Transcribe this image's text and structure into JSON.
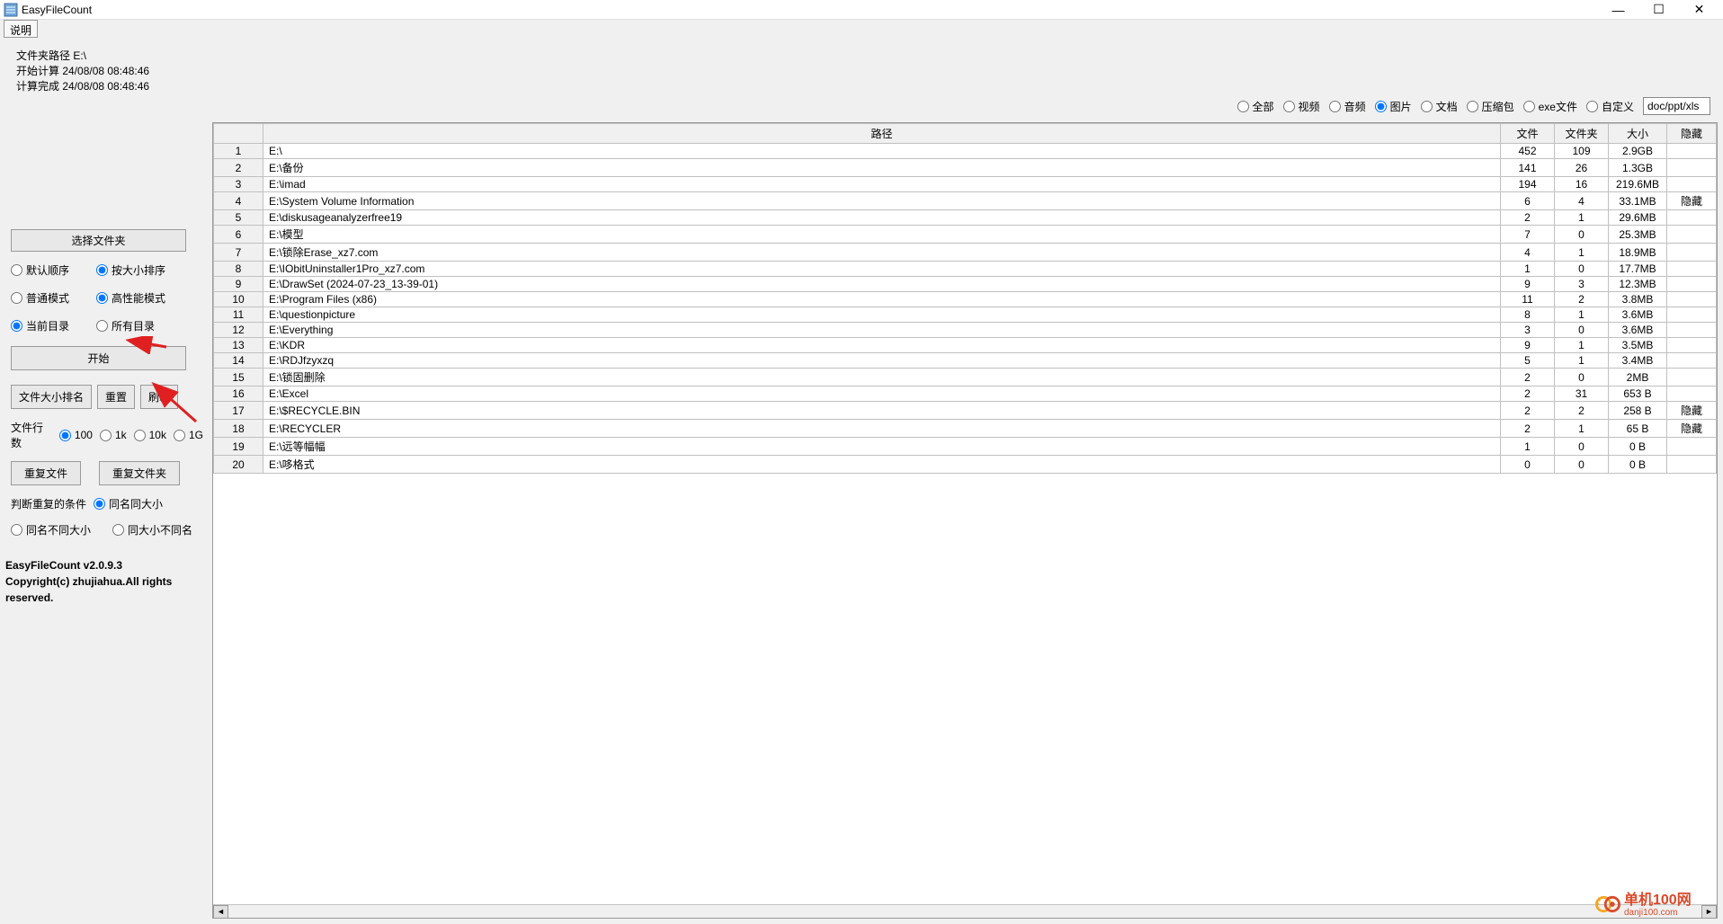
{
  "title": "EasyFileCount",
  "menu": {
    "help": "说明"
  },
  "info": {
    "l1": "文件夹路径 E:\\",
    "l2": "开始计算 24/08/08 08:48:46",
    "l3": "计算完成 24/08/08 08:48:46"
  },
  "sidebar": {
    "select_folder": "选择文件夹",
    "sort": {
      "default": "默认顺序",
      "size": "按大小排序"
    },
    "mode": {
      "normal": "普通模式",
      "high": "高性能模式"
    },
    "scope": {
      "current": "当前目录",
      "all": "所有目录"
    },
    "start": "开始",
    "btns3": {
      "file_rank": "文件大小排名",
      "reset": "重置",
      "refresh": "刷新"
    },
    "rows_label": "文件行数",
    "rows": {
      "r100": "100",
      "r1k": "1k",
      "r10k": "10k",
      "r1g": "1G"
    },
    "dup": {
      "file": "重复文件",
      "folder": "重复文件夹"
    },
    "dup_label": "判断重复的条件",
    "dup_cond": {
      "a": "同名同大小",
      "b": "同名不同大小",
      "c": "同大小不同名"
    },
    "version": "EasyFileCount v2.0.9.3",
    "copyright": "Copyright(c) zhujiahua.All rights reserved."
  },
  "filter": {
    "all": "全部",
    "video": "视频",
    "audio": "音频",
    "image": "图片",
    "doc": "文档",
    "archive": "压缩包",
    "exe": "exe文件",
    "custom": "自定义",
    "input_value": "doc/ppt/xls"
  },
  "table": {
    "headers": {
      "idx": "",
      "path": "路径",
      "file": "文件",
      "folder": "文件夹",
      "size": "大小",
      "hidden": "隐藏"
    },
    "rows": [
      {
        "idx": "1",
        "path": "E:\\",
        "file": "452",
        "folder": "109",
        "size": "2.9GB",
        "hidden": ""
      },
      {
        "idx": "2",
        "path": "E:\\备份",
        "file": "141",
        "folder": "26",
        "size": "1.3GB",
        "hidden": ""
      },
      {
        "idx": "3",
        "path": "E:\\imad",
        "file": "194",
        "folder": "16",
        "size": "219.6MB",
        "hidden": ""
      },
      {
        "idx": "4",
        "path": "E:\\System Volume Information",
        "file": "6",
        "folder": "4",
        "size": "33.1MB",
        "hidden": "隐藏"
      },
      {
        "idx": "5",
        "path": "E:\\diskusageanalyzerfree19",
        "file": "2",
        "folder": "1",
        "size": "29.6MB",
        "hidden": ""
      },
      {
        "idx": "6",
        "path": "E:\\模型",
        "file": "7",
        "folder": "0",
        "size": "25.3MB",
        "hidden": ""
      },
      {
        "idx": "7",
        "path": "E:\\锁除Erase_xz7.com",
        "file": "4",
        "folder": "1",
        "size": "18.9MB",
        "hidden": ""
      },
      {
        "idx": "8",
        "path": "E:\\IObitUninstaller1Pro_xz7.com",
        "file": "1",
        "folder": "0",
        "size": "17.7MB",
        "hidden": ""
      },
      {
        "idx": "9",
        "path": "E:\\DrawSet (2024-07-23_13-39-01)",
        "file": "9",
        "folder": "3",
        "size": "12.3MB",
        "hidden": ""
      },
      {
        "idx": "10",
        "path": "E:\\Program Files (x86)",
        "file": "11",
        "folder": "2",
        "size": "3.8MB",
        "hidden": ""
      },
      {
        "idx": "11",
        "path": "E:\\questionpicture",
        "file": "8",
        "folder": "1",
        "size": "3.6MB",
        "hidden": ""
      },
      {
        "idx": "12",
        "path": "E:\\Everything",
        "file": "3",
        "folder": "0",
        "size": "3.6MB",
        "hidden": ""
      },
      {
        "idx": "13",
        "path": "E:\\KDR",
        "file": "9",
        "folder": "1",
        "size": "3.5MB",
        "hidden": ""
      },
      {
        "idx": "14",
        "path": "E:\\RDJfzyxzq",
        "file": "5",
        "folder": "1",
        "size": "3.4MB",
        "hidden": ""
      },
      {
        "idx": "15",
        "path": "E:\\锁固删除",
        "file": "2",
        "folder": "0",
        "size": "2MB",
        "hidden": ""
      },
      {
        "idx": "16",
        "path": "E:\\Excel",
        "file": "2",
        "folder": "31",
        "size": "653 B",
        "hidden": ""
      },
      {
        "idx": "17",
        "path": "E:\\$RECYCLE.BIN",
        "file": "2",
        "folder": "2",
        "size": "258 B",
        "hidden": "隐藏"
      },
      {
        "idx": "18",
        "path": "E:\\RECYCLER",
        "file": "2",
        "folder": "1",
        "size": "65 B",
        "hidden": "隐藏"
      },
      {
        "idx": "19",
        "path": "E:\\远等幅幅",
        "file": "1",
        "folder": "0",
        "size": "0 B",
        "hidden": ""
      },
      {
        "idx": "20",
        "path": "E:\\哆格式",
        "file": "0",
        "folder": "0",
        "size": "0 B",
        "hidden": ""
      }
    ]
  },
  "watermark": {
    "name": "单机100网",
    "url": "danji100.com"
  }
}
